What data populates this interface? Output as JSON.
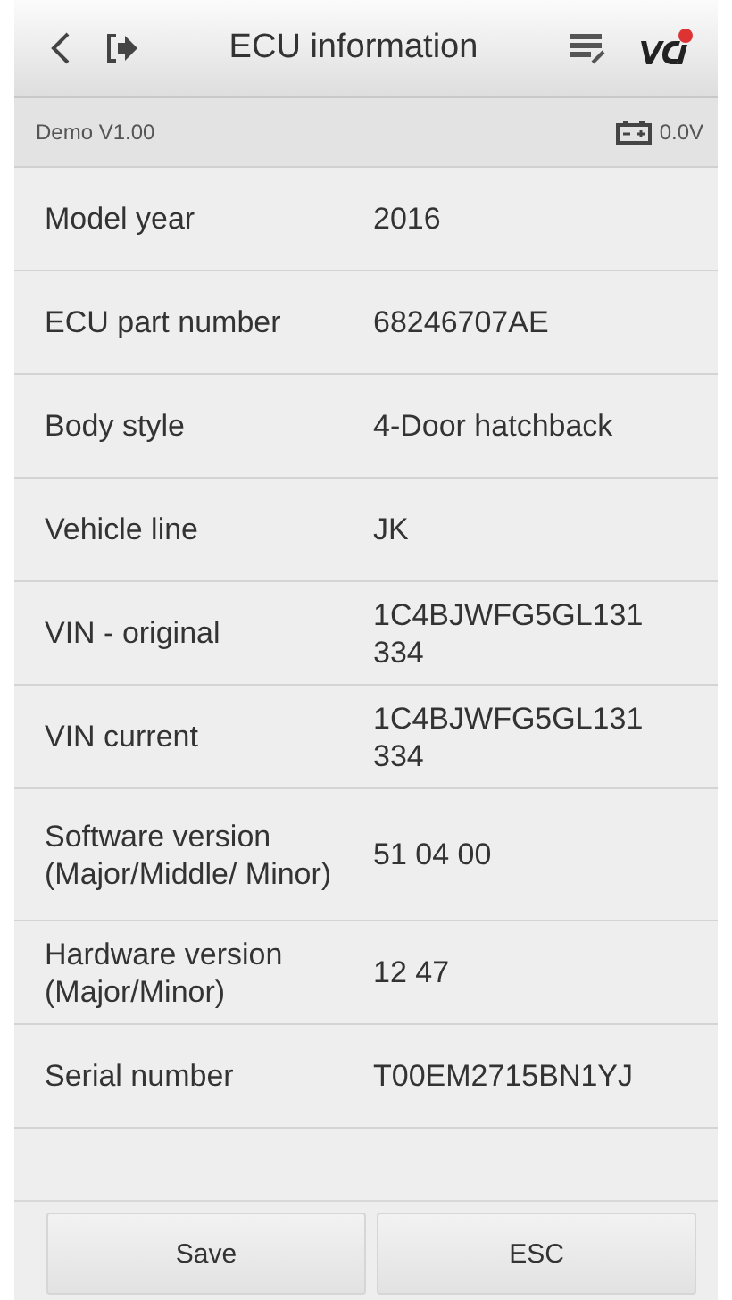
{
  "header": {
    "title": "ECU information"
  },
  "status_bar": {
    "version": "Demo V1.00",
    "voltage": "0.0V"
  },
  "rows": [
    {
      "label": "Model year",
      "value": "2016"
    },
    {
      "label": "ECU part number",
      "value": "68246707AE"
    },
    {
      "label": "Body style",
      "value": "4-Door hatchback"
    },
    {
      "label": "Vehicle line",
      "value": "JK"
    },
    {
      "label": "VIN - original",
      "value": "1C4BJWFG5GL131334"
    },
    {
      "label": "VIN current",
      "value": "1C4BJWFG5GL131334"
    },
    {
      "label": "Software version (Major/Middle/ Minor)",
      "value": "51 04 00"
    },
    {
      "label": "Hardware version (Major/Minor)",
      "value": "12 47"
    },
    {
      "label": "Serial number",
      "value": "T00EM2715BN1YJ"
    }
  ],
  "buttons": [
    "Save",
    "ESC"
  ]
}
